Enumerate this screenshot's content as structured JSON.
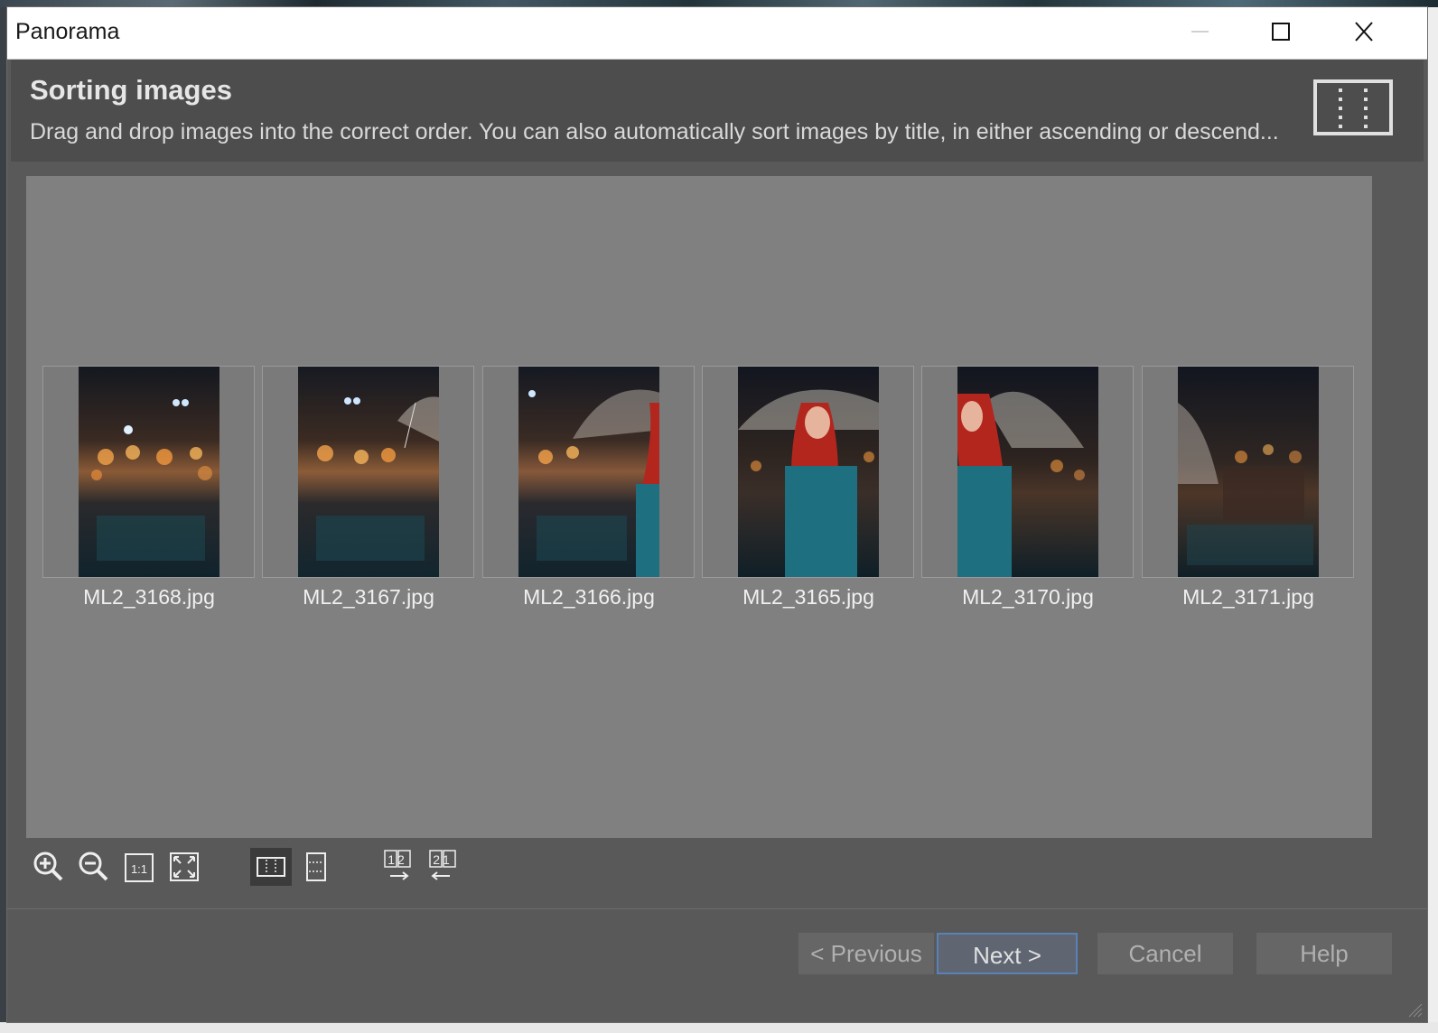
{
  "window": {
    "title": "Panorama",
    "controls": [
      "minimize-icon",
      "maximize-icon",
      "close-icon"
    ]
  },
  "header": {
    "title": "Sorting images",
    "description": "Drag and drop images into the correct order. You can also automatically sort images by title, in either ascending or descend...",
    "icon": "panorama-layout-icon"
  },
  "thumbnails": [
    {
      "filename": "ML2_3168.jpg"
    },
    {
      "filename": "ML2_3167.jpg"
    },
    {
      "filename": "ML2_3166.jpg"
    },
    {
      "filename": "ML2_3165.jpg"
    },
    {
      "filename": "ML2_3170.jpg"
    },
    {
      "filename": "ML2_3171.jpg"
    }
  ],
  "toolbar": {
    "zoom_in": "zoom-in-icon",
    "zoom_out": "zoom-out-icon",
    "actual_size": "1:1",
    "fit": "fit-to-window-icon",
    "layout_horizontal": "horizontal-layout-icon",
    "layout_vertical": "vertical-layout-icon",
    "sort_asc_label": "12",
    "sort_desc_label": "21"
  },
  "footer": {
    "previous": "< Previous",
    "next": "Next >",
    "cancel": "Cancel",
    "help": "Help"
  },
  "colors": {
    "dialog_bg": "#595959",
    "header_bg": "#4d4d4d",
    "canvas_bg": "#808080",
    "accent_border": "#5a82b8"
  }
}
